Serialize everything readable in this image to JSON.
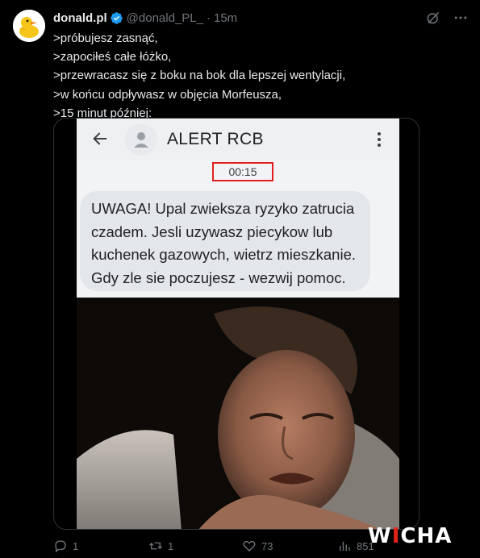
{
  "author": {
    "display_name": "donald.pl",
    "handle": "@donald_PL_",
    "separator": "·",
    "time_ago": "15m",
    "verified": true,
    "avatar": "yellow-rubber-duck"
  },
  "tweet": {
    "lines": [
      ">próbujesz zasnąć,",
      ">zapociłeś całe łóżko,",
      ">przewracasz się z boku na bok dla lepszej wentylacji,",
      ">w końcu odpływasz w objęcia Morfeusza,",
      ">15 minut później:"
    ]
  },
  "media": {
    "phone": {
      "title": "ALERT RCB",
      "timestamp": "00:15",
      "message_lines": [
        "UWAGA! Upal zwieksza ryzyko zatrucia",
        "czadem. Jesli uzywasz piecykow lub",
        "kuchenek gazowych, wietrz mieszkanie.",
        "Gdy zle sie poczujesz - wezwij pomoc."
      ]
    },
    "photo": "man-waking-up-in-bed"
  },
  "actions": {
    "replies": "1",
    "reposts": "1",
    "likes": "73",
    "views": "851"
  },
  "watermark": {
    "text_white_1": "W",
    "text_red": "I",
    "text_white_2": "CHA"
  },
  "colors": {
    "background": "#000000",
    "text": "#e7e9ea",
    "muted": "#71767b",
    "verified": "#1d9bf0",
    "highlight_box": "#e02020"
  }
}
